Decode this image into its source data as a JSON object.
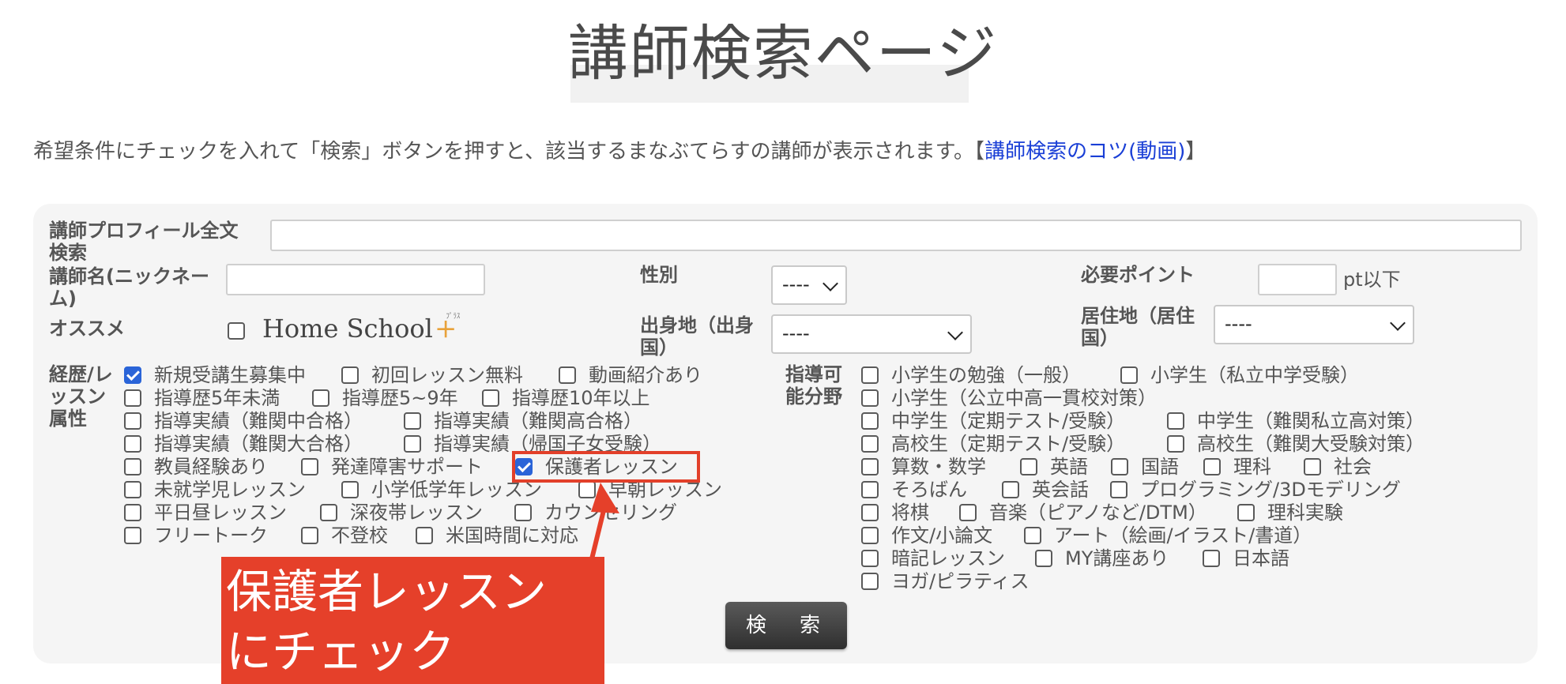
{
  "page": {
    "title": "講師検索ページ",
    "intro_text": "希望条件にチェックを入れて「検索」ボタンを押すと、該当するまなぶてらすの講師が表示されます。【",
    "intro_link": "講師検索のコツ(動画)",
    "intro_close": "】"
  },
  "form": {
    "fulltext_label_line1": "講師プロフィール全文",
    "fulltext_label_line2": "検索",
    "fulltext_value": "",
    "name_label_line1": "講師名(ニックネー",
    "name_label_line2": "ム)",
    "name_value": "",
    "gender_label": "性別",
    "gender_value": "----",
    "points_label": "必要ポイント",
    "points_value": "",
    "points_unit": "pt以下",
    "recommend_label": "オススメ",
    "recommend_logo_text": "Home School",
    "recommend_logo_plus": "+",
    "recommend_logo_kana": "ﾌﾟﾗｽ",
    "birthplace_label_line1": "出身地（出身",
    "birthplace_label_line2": "国）",
    "birthplace_value": "----",
    "residence_label_line1": "居住地（居住",
    "residence_label_line2": "国）",
    "residence_value": "----",
    "career_label_line1": "経歴/レ",
    "career_label_line2": "ッスン",
    "career_label_line3": "属性",
    "subject_label_line1": "指導可",
    "subject_label_line2": "能分野",
    "search_button": "検　索"
  },
  "career_options": [
    {
      "label": "新規受講生募集中",
      "checked": true
    },
    {
      "label": "初回レッスン無料",
      "checked": false
    },
    {
      "label": "動画紹介あり",
      "checked": false
    },
    {
      "label": "指導歴5年未満",
      "checked": false
    },
    {
      "label": "指導歴5~9年",
      "checked": false
    },
    {
      "label": "指導歴10年以上",
      "checked": false
    },
    {
      "label": "指導実績（難関中合格）",
      "checked": false
    },
    {
      "label": "指導実績（難関高合格）",
      "checked": false
    },
    {
      "label": "指導実績（難関大合格）",
      "checked": false
    },
    {
      "label": "指導実績（帰国子女受験）",
      "checked": false
    },
    {
      "label": "教員経験あり",
      "checked": false
    },
    {
      "label": "発達障害サポート",
      "checked": false
    },
    {
      "label": "保護者レッスン",
      "checked": true
    },
    {
      "label": "未就学児レッスン",
      "checked": false
    },
    {
      "label": "小学低学年レッスン",
      "checked": false
    },
    {
      "label": "早朝レッスン",
      "checked": false
    },
    {
      "label": "平日昼レッスン",
      "checked": false
    },
    {
      "label": "深夜帯レッスン",
      "checked": false
    },
    {
      "label": "カウンセリング",
      "checked": false
    },
    {
      "label": "フリートーク",
      "checked": false
    },
    {
      "label": "不登校",
      "checked": false
    },
    {
      "label": "米国時間に対応",
      "checked": false
    }
  ],
  "subject_options": [
    {
      "label": "小学生の勉強（一般）",
      "checked": false
    },
    {
      "label": "小学生（私立中学受験）",
      "checked": false
    },
    {
      "label": "小学生（公立中高一貫校対策）",
      "checked": false
    },
    {
      "label": "中学生（定期テスト/受験）",
      "checked": false
    },
    {
      "label": "中学生（難関私立高対策）",
      "checked": false
    },
    {
      "label": "高校生（定期テスト/受験）",
      "checked": false
    },
    {
      "label": "高校生（難関大受験対策）",
      "checked": false
    },
    {
      "label": "算数・数学",
      "checked": false
    },
    {
      "label": "英語",
      "checked": false
    },
    {
      "label": "国語",
      "checked": false
    },
    {
      "label": "理科",
      "checked": false
    },
    {
      "label": "社会",
      "checked": false
    },
    {
      "label": "そろばん",
      "checked": false
    },
    {
      "label": "英会話",
      "checked": false
    },
    {
      "label": "プログラミング/3Dモデリング",
      "checked": false
    },
    {
      "label": "将棋",
      "checked": false
    },
    {
      "label": "音楽（ピアノなど/DTM）",
      "checked": false
    },
    {
      "label": "理科実験",
      "checked": false
    },
    {
      "label": "作文/小論文",
      "checked": false
    },
    {
      "label": "アート（絵画/イラスト/書道）",
      "checked": false
    },
    {
      "label": "暗記レッスン",
      "checked": false
    },
    {
      "label": "MY講座あり",
      "checked": false
    },
    {
      "label": "日本語",
      "checked": false
    },
    {
      "label": "ヨガ/ピラティス",
      "checked": false
    }
  ],
  "annotation": {
    "callout_line1": "保護者レッスン",
    "callout_line2": "にチェック",
    "color": "#e5402a"
  }
}
